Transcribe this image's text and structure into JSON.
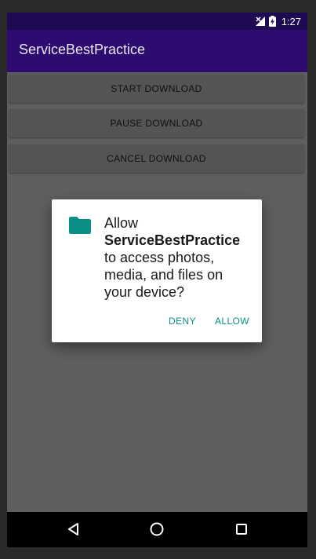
{
  "status_bar": {
    "time": "1:27",
    "icons": [
      "signal-off-icon",
      "battery-charging-icon"
    ]
  },
  "app_bar": {
    "title": "ServiceBestPractice"
  },
  "buttons": {
    "start": "START DOWNLOAD",
    "pause": "PAUSE DOWNLOAD",
    "cancel": "CANCEL DOWNLOAD"
  },
  "dialog": {
    "icon": "folder-icon",
    "prefix": "Allow",
    "app_name": "ServiceBestPractice",
    "suffix": "to access photos, media, and files on your device?",
    "deny": "DENY",
    "allow": "ALLOW"
  },
  "nav_bar": {
    "icons": [
      "back-icon",
      "home-icon",
      "recents-icon"
    ]
  },
  "colors": {
    "status_bar": "#1e0a52",
    "app_bar": "#2c0c6e",
    "dialog_accent": "#0a8f86",
    "scrim_background": "#5f5f5f"
  }
}
